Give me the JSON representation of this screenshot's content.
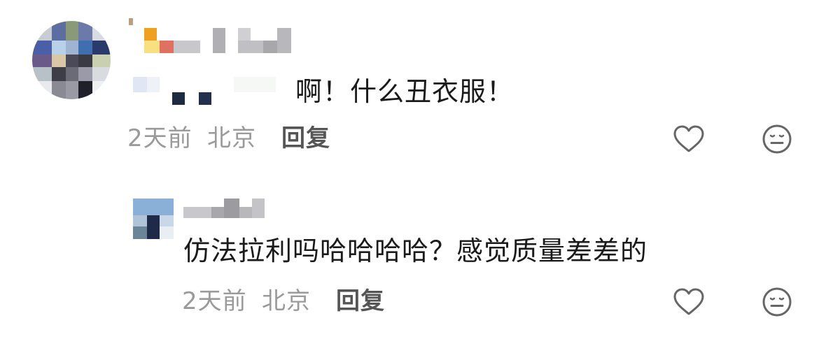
{
  "comments": [
    {
      "text": "啊！什么丑衣服！",
      "time": "2天前",
      "location": "北京",
      "reply_label": "回复",
      "like_icon": "heart-outline-icon",
      "dislike_icon": "neutral-face-icon"
    }
  ],
  "replies": [
    {
      "text": "仿法拉利吗哈哈哈哈？感觉质量差差的",
      "time": "2天前",
      "location": "北京",
      "reply_label": "回复",
      "like_icon": "heart-outline-icon",
      "dislike_icon": "neutral-face-icon"
    }
  ],
  "colors": {
    "text": "#1a1a1a",
    "meta": "#9a9a9a",
    "reply": "#555555",
    "icon": "#666666"
  }
}
